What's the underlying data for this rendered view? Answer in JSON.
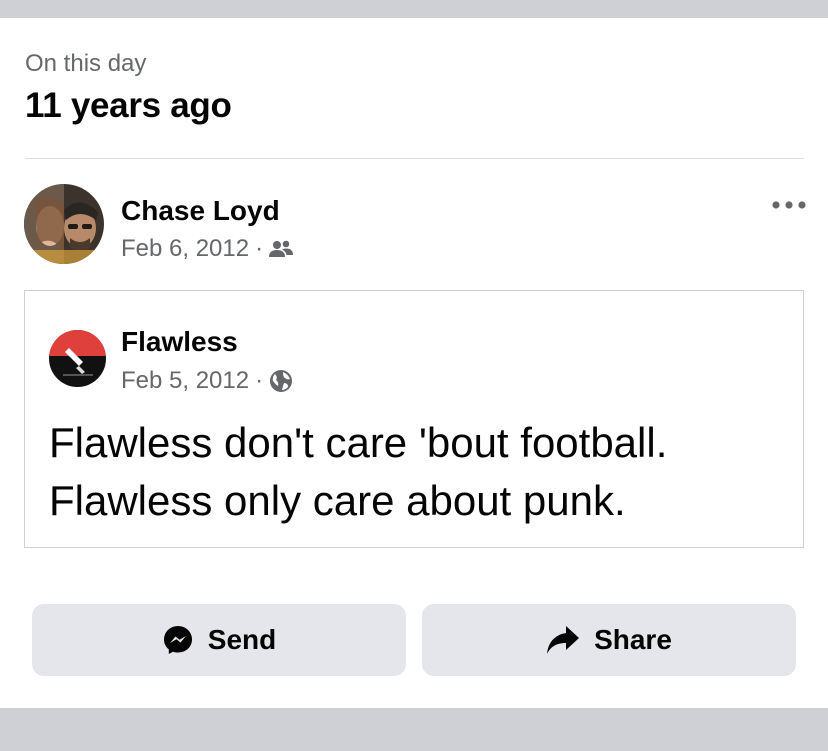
{
  "memory": {
    "subtitle": "On this day",
    "title": "11 years ago"
  },
  "post": {
    "author": "Chase Loyd",
    "date": "Feb 6, 2012",
    "separator": "·",
    "audience_icon": "friends-icon",
    "more_icon": "more-options-icon"
  },
  "shared_post": {
    "page_name": "Flawless",
    "date": "Feb 5, 2012",
    "separator": "·",
    "audience_icon": "globe-icon",
    "text_line1": "Flawless don't care 'bout football.",
    "text_line2": "Flawless only care about punk."
  },
  "actions": {
    "send_label": "Send",
    "send_icon": "messenger-icon",
    "share_label": "Share",
    "share_icon": "share-arrow-icon"
  },
  "colors": {
    "secondary_text": "#65676b",
    "primary_text": "#050505",
    "button_bg": "#e4e6eb",
    "frame_bar": "#cfd0d5",
    "divider": "#dadde1"
  }
}
